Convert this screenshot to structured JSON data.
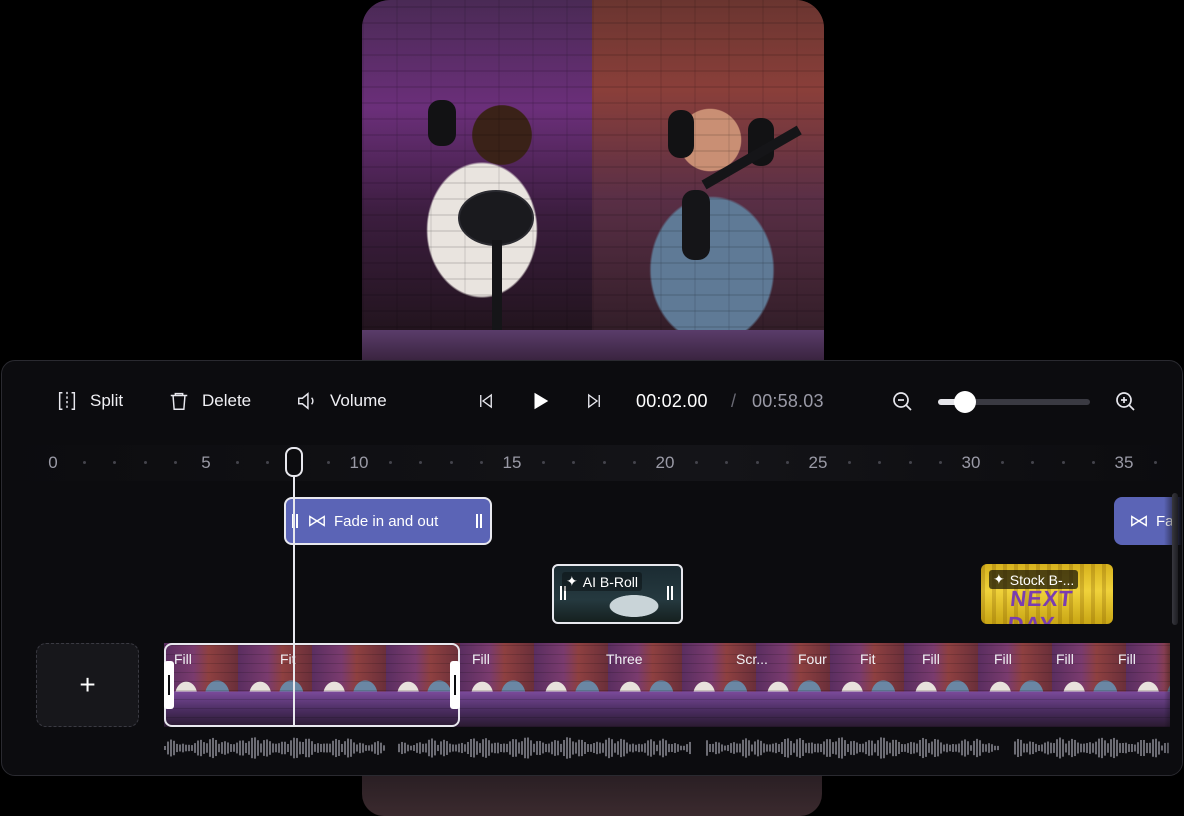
{
  "toolbar": {
    "split_label": "Split",
    "delete_label": "Delete",
    "volume_label": "Volume",
    "current_time": "00:02.00",
    "separator": "/",
    "total_time": "00:58.03",
    "zoom_level_fraction": 0.18
  },
  "ruler": {
    "labels": [
      "0",
      "5",
      "10",
      "15",
      "20",
      "25",
      "30",
      "35"
    ]
  },
  "tracks": {
    "transitions": [
      {
        "label": "Fade in and out"
      },
      {
        "label": "Fa"
      }
    ],
    "broll": [
      {
        "label": "AI B-Roll",
        "icon": "sparkle-icon"
      },
      {
        "label": "Stock B-...",
        "icon": "sparkle-icon",
        "thumbnail_text": "NEXT DAY"
      }
    ],
    "video_frame_labels": [
      "Fill",
      "Fit",
      "Fill",
      "Three",
      "Scr...",
      "Four",
      "Fit",
      "Fill",
      "Fill",
      "Fill",
      "Fill"
    ],
    "add_label": "+"
  },
  "colors": {
    "panel_bg": "#0c0c0f",
    "transition_clip": "#5b64b6",
    "accent_white": "#e8e8ee",
    "text_muted": "#9a9aa6"
  }
}
